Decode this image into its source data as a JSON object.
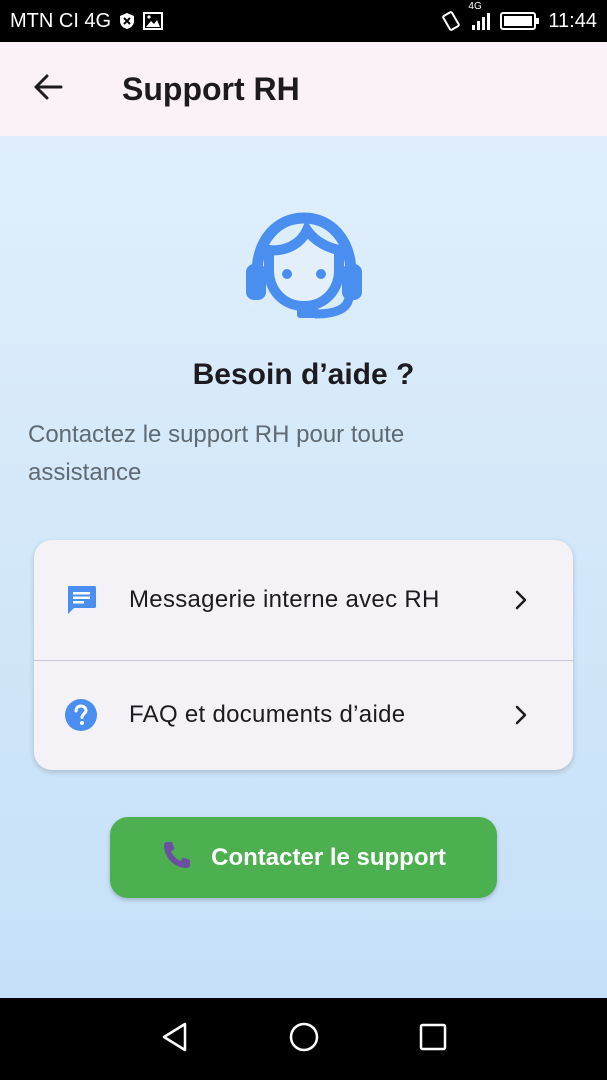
{
  "status_bar": {
    "carrier": "MTN CI 4G",
    "network": "4G",
    "time": "11:44"
  },
  "app_bar": {
    "title": "Support RH",
    "back_icon": "arrow-left-icon"
  },
  "main": {
    "illustration_icon": "headset-support-icon",
    "heading": "Besoin d’aide ?",
    "subtitle": "Contactez le support RH pour toute assistance",
    "options": [
      {
        "icon": "chat-message-icon",
        "label": "Messagerie interne avec RH"
      },
      {
        "icon": "help-circle-icon",
        "label": "FAQ et documents d’aide"
      }
    ],
    "contact_button": {
      "icon": "phone-icon",
      "label": "Contacter le support"
    }
  },
  "colors": {
    "accent_blue": "#4a8ef0",
    "button_green": "#4caf50",
    "phone_icon_purple": "#6b4fa0",
    "app_bar_bg": "#fbf1f8"
  }
}
